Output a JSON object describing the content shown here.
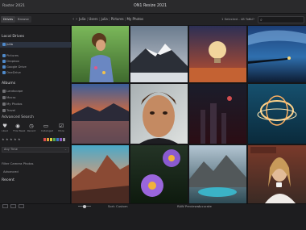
{
  "app": {
    "title": "Raster 2021",
    "window_title": "ON1 Resize 2021"
  },
  "toolbar": {
    "tabs": [
      "Drives",
      "Browse"
    ],
    "back": "‹",
    "forward": "›",
    "breadcrumb": [
      "Julia",
      "Users",
      "julia",
      "Pictures",
      "My Photos"
    ],
    "selection_count": "1 Selected - 48 Total",
    "search_placeholder": ""
  },
  "sidebar": {
    "local_drives": {
      "title": "Local Drives",
      "items": [
        "Julia",
        "Pictures",
        "Dropbox",
        "Google Drive",
        "OneDrive"
      ]
    },
    "albums": {
      "title": "Albums",
      "items": [
        "Landscape",
        "Macro",
        "My Photos",
        "Travel"
      ]
    },
    "advanced_search": {
      "title": "Advanced Search",
      "filters": [
        {
          "icon": "heart-icon",
          "glyph": "♥",
          "label": "Liked"
        },
        {
          "icon": "camera-icon",
          "glyph": "◉",
          "label": "This Week"
        },
        {
          "icon": "clock-icon",
          "glyph": "◷",
          "label": "Recent"
        },
        {
          "icon": "folder-icon",
          "glyph": "▭",
          "label": "Cataloged"
        },
        {
          "icon": "check-icon",
          "glyph": "☑",
          "label": "More"
        }
      ],
      "stars": [
        "★",
        "★",
        "★",
        "★",
        "★"
      ],
      "color_labels": [
        "#d94b4b",
        "#e0a33a",
        "#d8cf3d",
        "#4fa656",
        "#3c78c9",
        "#8d58c2",
        "#9a9a9e"
      ]
    },
    "any_time": "Any Time",
    "filter_camera": "Filter Camera Photos",
    "advanced": "Advanced",
    "recent": {
      "title": "Recent"
    }
  },
  "footer": {
    "view_mode": "Grid",
    "sort": "Sort:",
    "sort_value": "Custom",
    "raw_previews": "RAW Previews:",
    "raw_value": "Accurate"
  },
  "colors": {
    "accent": "#4f89c9",
    "background": "#1b1b1d"
  }
}
